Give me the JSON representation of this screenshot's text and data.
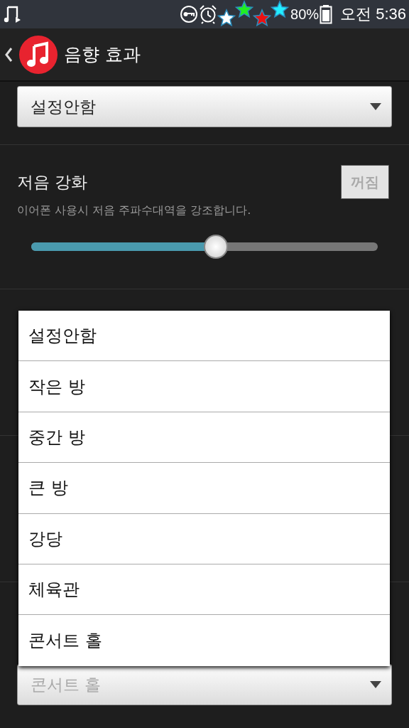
{
  "status_bar": {
    "time": "오전 5:36",
    "battery": "80%",
    "stars": [
      {
        "color": "#ffffff"
      },
      {
        "color": "#22ee22"
      },
      {
        "color": "#ee1111"
      },
      {
        "color": "#22eeff"
      }
    ]
  },
  "action_bar": {
    "title": "음향 효과"
  },
  "top_dropdown": {
    "value": "설정안함"
  },
  "bass_boost": {
    "title": "저음 강화",
    "toggle": {
      "label": "꺼짐",
      "on": false
    },
    "description": "이어폰 사용시 저음 주파수대역을 강조합니다.",
    "level": 0.5
  },
  "popup": {
    "items": [
      {
        "label": "설정안함"
      },
      {
        "label": "작은 방"
      },
      {
        "label": "중간 방"
      },
      {
        "label": "큰 방"
      },
      {
        "label": "강당"
      },
      {
        "label": "체육관"
      },
      {
        "label": "콘서트 홀"
      }
    ]
  },
  "bottom_dropdown": {
    "value": "콘서트 홀",
    "disabled": true
  }
}
